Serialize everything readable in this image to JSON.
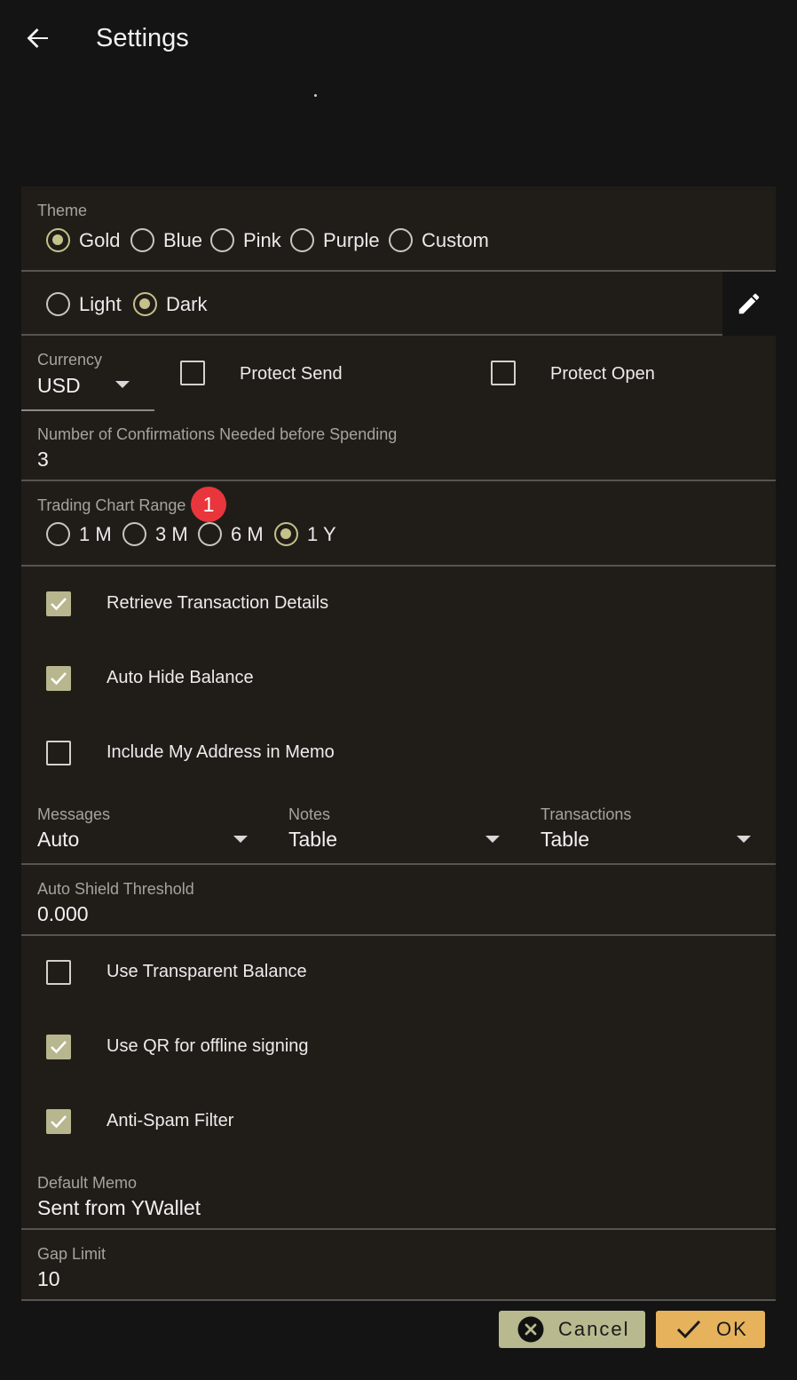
{
  "header": {
    "title": "Settings"
  },
  "theme": {
    "label": "Theme",
    "options": [
      "Gold",
      "Blue",
      "Pink",
      "Purple",
      "Custom"
    ],
    "selected": "Gold",
    "brightness_options": [
      "Light",
      "Dark"
    ],
    "brightness_selected": "Dark"
  },
  "currency": {
    "label": "Currency",
    "value": "USD"
  },
  "protect_send": {
    "label": "Protect Send",
    "checked": false
  },
  "protect_open": {
    "label": "Protect Open",
    "checked": false
  },
  "confirmations": {
    "label": "Number of Confirmations Needed before Spending",
    "value": "3"
  },
  "chart_range": {
    "label": "Trading Chart Range",
    "badge": "1",
    "options": [
      "1 M",
      "3 M",
      "6 M",
      "1 Y"
    ],
    "selected": "1 Y"
  },
  "checkboxes_a": [
    {
      "label": "Retrieve Transaction Details",
      "checked": true
    },
    {
      "label": "Auto Hide Balance",
      "checked": true
    },
    {
      "label": "Include My Address in Memo",
      "checked": false
    }
  ],
  "views": [
    {
      "label": "Messages",
      "value": "Auto"
    },
    {
      "label": "Notes",
      "value": "Table"
    },
    {
      "label": "Transactions",
      "value": "Table"
    }
  ],
  "auto_shield": {
    "label": "Auto Shield Threshold",
    "value": "0.000"
  },
  "checkboxes_b": [
    {
      "label": "Use Transparent Balance",
      "checked": false
    },
    {
      "label": "Use QR for offline signing",
      "checked": true
    },
    {
      "label": "Anti-Spam Filter",
      "checked": true
    }
  ],
  "default_memo": {
    "label": "Default Memo",
    "value": "Sent from YWallet"
  },
  "gap_limit": {
    "label": "Gap Limit",
    "value": "10"
  },
  "buttons": {
    "cancel": "Cancel",
    "ok": "OK"
  },
  "colors": {
    "accent": "#c5c18a",
    "checkbox_on": "#b7b68e",
    "ok_button": "#e6b25c",
    "cancel_button": "#b8b98f",
    "badge": "#e8363c",
    "panel": "#201d19",
    "background": "#141414"
  },
  "icons": {
    "back": "arrow-left-icon",
    "edit": "pencil-icon",
    "cancel": "close-circle-icon",
    "ok": "check-icon"
  }
}
